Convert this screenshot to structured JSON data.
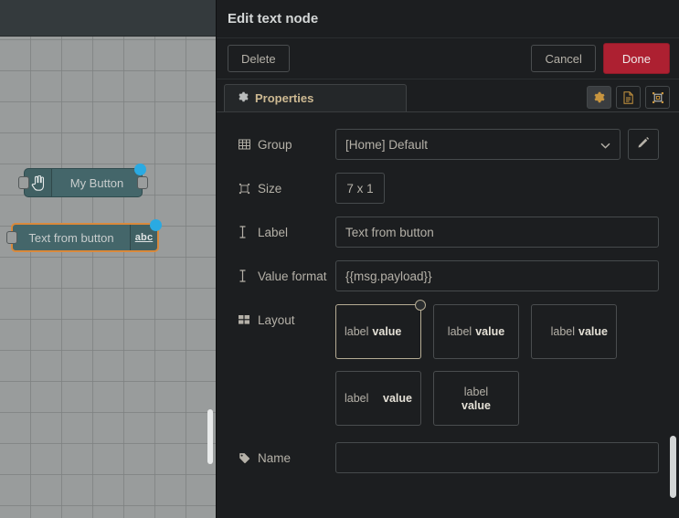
{
  "canvas": {
    "nodes": [
      {
        "label": "My Button",
        "icon": "pointer-hand-icon",
        "icon_side": "left",
        "selected": false,
        "label_align": "center"
      },
      {
        "label": "Text from button",
        "icon": "abc-icon",
        "icon_text": "abc",
        "icon_side": "right",
        "selected": true,
        "label_align": "center"
      }
    ]
  },
  "dialog": {
    "title": "Edit text node",
    "actions": {
      "delete_label": "Delete",
      "cancel_label": "Cancel",
      "done_label": "Done",
      "done_color": "#ad2031"
    },
    "tabs": [
      {
        "label": "Properties",
        "icon": "gear-icon",
        "active": true
      }
    ],
    "tab_tools": [
      {
        "name": "gear-icon",
        "active": true
      },
      {
        "name": "document-icon",
        "active": false
      },
      {
        "name": "resize-icon",
        "active": false
      }
    ],
    "fields": {
      "group": {
        "label": "Group",
        "icon": "table-grid-icon",
        "value": "[Home] Default",
        "edit_icon": "pencil-icon"
      },
      "size": {
        "label": "Size",
        "icon": "resize-icon",
        "value": "7 x 1"
      },
      "label": {
        "label": "Label",
        "icon": "text-cursor-icon",
        "value": "Text from button",
        "placeholder": ""
      },
      "value_format": {
        "label": "Value format",
        "icon": "text-cursor-icon",
        "value": "{{msg.payload}}",
        "placeholder": ""
      },
      "layout": {
        "label": "Layout",
        "icon": "layout-grid-icon",
        "options": [
          {
            "label_text": "label",
            "value_text": "value",
            "align": "a",
            "selected": true
          },
          {
            "label_text": "label",
            "value_text": "value",
            "align": "b",
            "selected": false
          },
          {
            "label_text": "label",
            "value_text": "value",
            "align": "c",
            "selected": false
          },
          {
            "label_text": "label",
            "value_text": "value",
            "align": "d",
            "selected": false
          },
          {
            "label_text": "label",
            "value_text": "value",
            "align": "e",
            "selected": false
          }
        ]
      },
      "name": {
        "label": "Name",
        "icon": "tag-icon",
        "value": "",
        "placeholder": ""
      }
    }
  }
}
